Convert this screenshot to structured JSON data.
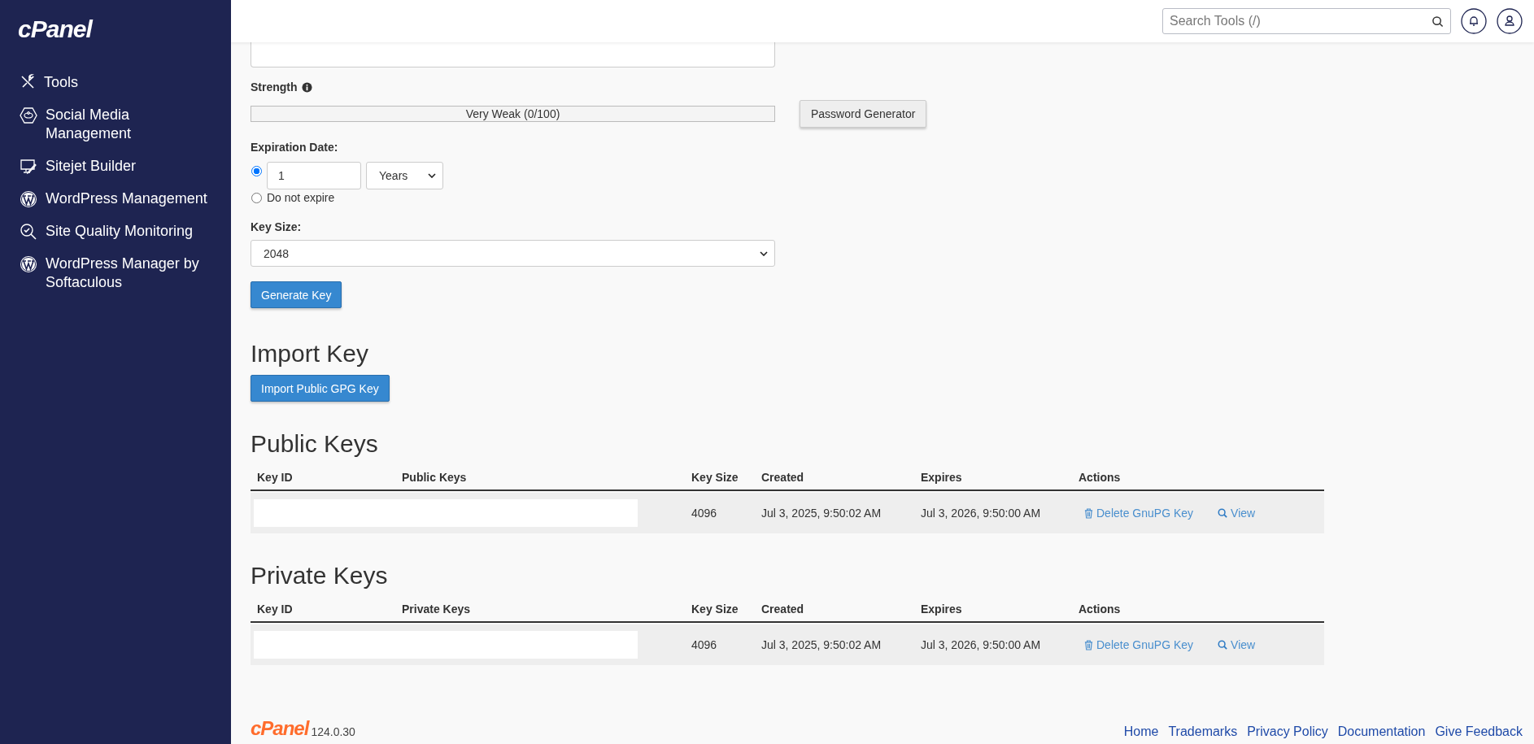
{
  "sidebar": {
    "logo": "cPanel",
    "items": [
      {
        "label": "Tools"
      },
      {
        "label": "Social Media Management"
      },
      {
        "label": "Sitejet Builder"
      },
      {
        "label": "WordPress Management"
      },
      {
        "label": "Site Quality Monitoring"
      },
      {
        "label": "WordPress Manager by Softaculous"
      }
    ]
  },
  "topbar": {
    "search": {
      "placeholder": "Search Tools (/)"
    }
  },
  "generate_form": {
    "strength": {
      "label": "Strength",
      "reading": "Very Weak (0/100)"
    },
    "password_generator": "Password Generator",
    "expiration": {
      "label": "Expiration Date:",
      "options": [
        {
          "kind": "amount",
          "selected": true,
          "value": "1",
          "unit": "Years"
        },
        {
          "kind": "never",
          "selected": false,
          "label": "Do not expire"
        }
      ]
    },
    "key_size": {
      "label": "Key Size:",
      "value": "2048"
    },
    "submit": "Generate Key"
  },
  "import": {
    "title": "Import Key",
    "button": "Import Public GPG Key"
  },
  "tables": [
    {
      "title": "Public Keys",
      "columns": [
        "Key ID",
        "Public Keys",
        "Key Size",
        "Created",
        "Expires",
        "Actions"
      ],
      "rows": [
        {
          "key_size": "4096",
          "created": "Jul 3, 2025, 9:50:02 AM",
          "expires": "Jul 3, 2026, 9:50:00 AM",
          "actions": [
            "Delete GnuPG Key",
            "View"
          ]
        }
      ]
    },
    {
      "title": "Private Keys",
      "columns": [
        "Key ID",
        "Private Keys",
        "Key Size",
        "Created",
        "Expires",
        "Actions"
      ],
      "rows": [
        {
          "key_size": "4096",
          "created": "Jul 3, 2025, 9:50:02 AM",
          "expires": "Jul 3, 2026, 9:50:00 AM",
          "actions": [
            "Delete GnuPG Key",
            "View"
          ]
        }
      ]
    }
  ],
  "footer": {
    "logo": "cPanel",
    "version": "124.0.30",
    "links": [
      "Home",
      "Trademarks",
      "Privacy Policy",
      "Documentation",
      "Give Feedback"
    ]
  }
}
